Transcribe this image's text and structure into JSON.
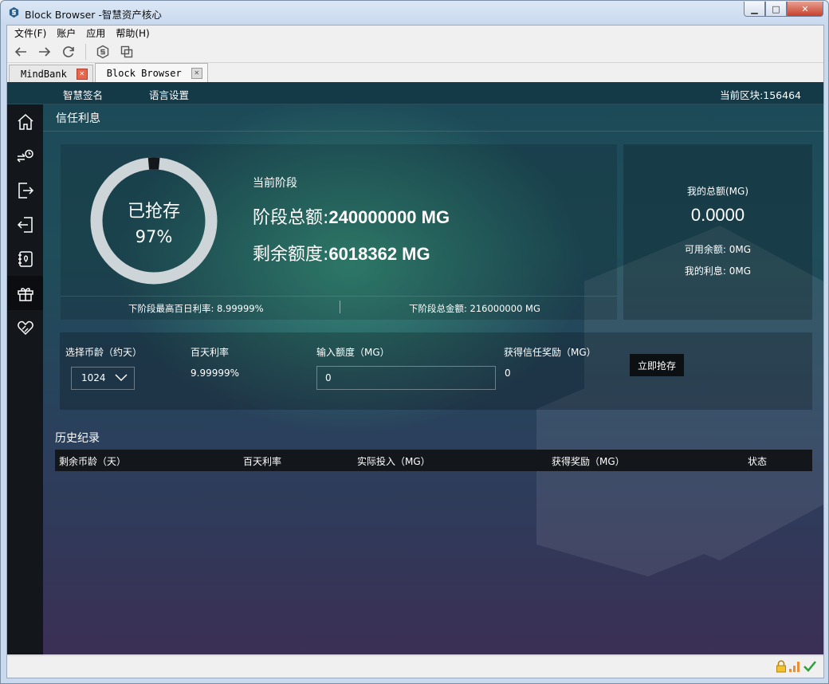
{
  "window": {
    "title": "Block Browser -智慧资产核心"
  },
  "menu": [
    "文件(F)",
    "账户",
    "应用",
    "帮助(H)"
  ],
  "tabs": [
    {
      "label": "MindBank",
      "active": false
    },
    {
      "label": "Block Browser",
      "active": true
    }
  ],
  "topnav": {
    "items": [
      "智慧签名",
      "语言设置"
    ],
    "block_label": "当前区块:156464"
  },
  "sidebar": [
    "home-icon",
    "exchange-clock-icon",
    "export-icon",
    "import-icon",
    "contacts-icon",
    "gift-icon",
    "charity-heart-icon"
  ],
  "page": {
    "title": "信任利息"
  },
  "stage": {
    "progress": 0.97,
    "ring_label": "已抢存",
    "ring_pct": "97%",
    "current": "当前阶段",
    "total_label": "阶段总额:",
    "total_value": "240000000 MG",
    "remain_label": "剩余额度:",
    "remain_value": "6018362 MG",
    "next_rate": "下阶段最高百日利率: 8.99999%",
    "next_total": "下阶段总金额: 216000000 MG"
  },
  "my": {
    "title": "我的总额(MG)",
    "value": "0.0000",
    "available": "可用余额: 0MG",
    "interest": "我的利息: 0MG"
  },
  "form": {
    "coin_age_label": "选择币龄（约天）",
    "coin_age_value": "1024",
    "rate_label": "百天利率",
    "rate_value": "9.99999%",
    "amount_label": "输入额度（MG）",
    "amount_value": "0",
    "reward_label": "获得信任奖励（MG）",
    "reward_value": "0",
    "submit_label": "立即抢存"
  },
  "history": {
    "title": "历史纪录",
    "columns": [
      "剩余币龄（天）",
      "百天利率",
      "实际投入（MG）",
      "获得奖励（MG）",
      "状态"
    ]
  },
  "colors": {
    "ring_track": "#cdd5d9",
    "ring_gap": "#13171c",
    "panel_dark": "#13171c"
  }
}
